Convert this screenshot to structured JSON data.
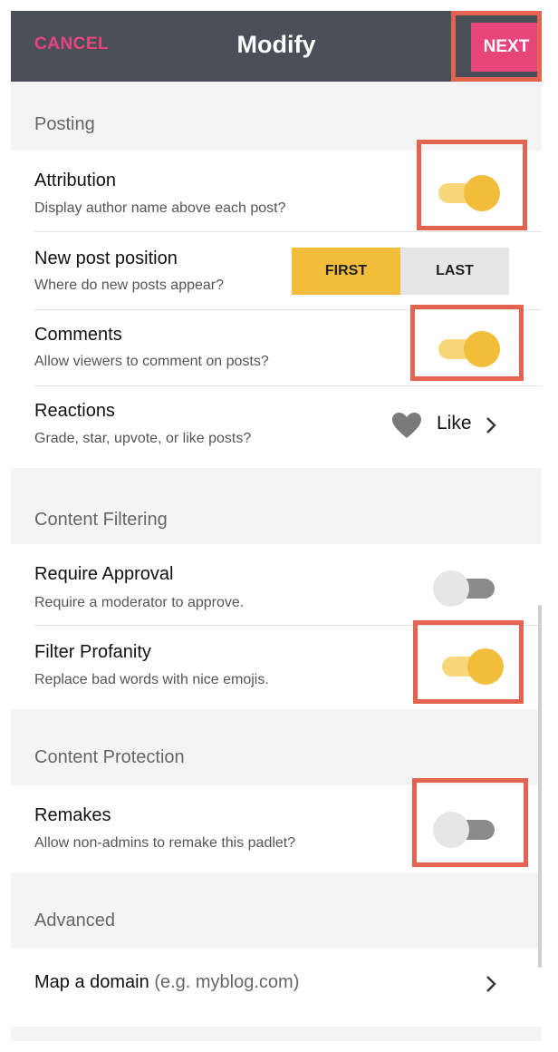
{
  "header": {
    "cancel_label": "CANCEL",
    "title": "Modify",
    "next_label": "NEXT"
  },
  "colors": {
    "header_bg": "#4a4f58",
    "accent_pink": "#e8457a",
    "toggle_on": "#f2bd3a",
    "highlight": "#e2634f"
  },
  "sections": {
    "posting": "Posting",
    "content_filtering": "Content Filtering",
    "content_protection": "Content Protection",
    "advanced": "Advanced"
  },
  "posting": {
    "attribution": {
      "title": "Attribution",
      "subtitle": "Display author name above each post?",
      "enabled": true
    },
    "new_post_position": {
      "title": "New post position",
      "subtitle": "Where do new posts appear?",
      "options": [
        "FIRST",
        "LAST"
      ],
      "selected": "FIRST"
    },
    "comments": {
      "title": "Comments",
      "subtitle": "Allow viewers to comment on posts?",
      "enabled": true
    },
    "reactions": {
      "title": "Reactions",
      "subtitle": "Grade, star, upvote, or like posts?",
      "value": "Like",
      "icon": "heart-icon"
    }
  },
  "content_filtering": {
    "require_approval": {
      "title": "Require Approval",
      "subtitle": "Require a moderator to approve.",
      "enabled": false
    },
    "filter_profanity": {
      "title": "Filter Profanity",
      "subtitle": "Replace bad words with nice emojis.",
      "enabled": true
    }
  },
  "content_protection": {
    "remakes": {
      "title": "Remakes",
      "subtitle": "Allow non-admins to remake this padlet?",
      "enabled": false
    }
  },
  "advanced": {
    "map_domain": {
      "title": "Map a domain",
      "hint": "(e.g. myblog.com)"
    }
  }
}
